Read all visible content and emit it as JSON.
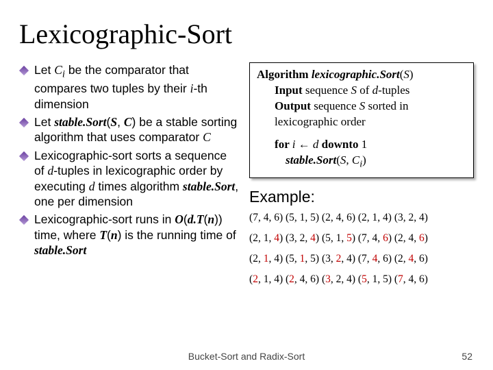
{
  "title": "Lexicographic-Sort",
  "bullets": {
    "b1a": "Let ",
    "b1b": "C",
    "b1c": "i",
    "b1d": " be the comparator that compares two tuples by their ",
    "b1e": "i",
    "b1f": "-th dimension",
    "b2a": "Let ",
    "b2b": "stable.Sort",
    "b2c": "(",
    "b2d": "S",
    "b2e": ", ",
    "b2f": "C",
    "b2g": ") be a stable sorting algorithm that uses comparator ",
    "b2h": "C",
    "b3a": "Lexicographic-sort sorts a sequence of ",
    "b3b": "d",
    "b3c": "-tuples in lexicographic order by executing ",
    "b3d": "d",
    "b3e": " times algorithm ",
    "b3f": "stable.Sort",
    "b3g": ", one per dimension",
    "b4a": "Lexicographic-sort runs in ",
    "b4b": "O",
    "b4c": "(",
    "b4d": "d.T",
    "b4e": "(",
    "b4f": "n",
    "b4g": ")) time, where ",
    "b4h": "T",
    "b4i": "(",
    "b4j": "n",
    "b4k": ") is the running time of ",
    "b4l": "stable.Sort"
  },
  "algo": {
    "l1a": "Algorithm ",
    "l1b": "lexicographic.Sort",
    "l1c": "(",
    "l1d": "S",
    "l1e": ")",
    "l2a": "Input ",
    "l2b": "sequence ",
    "l2c": "S",
    "l2d": " of ",
    "l2e": "d",
    "l2f": "-tuples",
    "l3a": "Output ",
    "l3b": "sequence ",
    "l3c": "S",
    "l3d": " sorted in lexicographic order",
    "l4a": "for ",
    "l4b": "i",
    "l4c": " ← ",
    "l4d": "d",
    "l4e": " downto ",
    "l4f": "1",
    "l5a": "stable.Sort",
    "l5b": "(",
    "l5c": "S",
    "l5d": ", ",
    "l5e": "C",
    "l5f": "i",
    "l5g": ")"
  },
  "example_head": "Example:",
  "ex": {
    "r1a": "(7, 4, 6) (5, 1, 5) (2, 4, 6) (2, 1, 4) (3, 2, 4)",
    "r2a": "(2, 1, ",
    "r2b": "4",
    "r2c": ") (3, 2, ",
    "r2d": "4",
    "r2e": ") (5, 1, ",
    "r2f": "5",
    "r2g": ") (7, 4, ",
    "r2h": "6",
    "r2i": ") (2, 4, ",
    "r2j": "6",
    "r2k": ")",
    "r3a": "(2, ",
    "r3b": "1",
    "r3c": ", 4) (5, ",
    "r3d": "1",
    "r3e": ", 5) (3, ",
    "r3f": "2",
    "r3g": ", 4) (7, ",
    "r3h": "4",
    "r3i": ", 6) (2, ",
    "r3j": "4",
    "r3k": ", 6)",
    "r4a": "(",
    "r4b": "2",
    "r4c": ", 1, 4) (",
    "r4d": "2",
    "r4e": ", 4, 6) (",
    "r4f": "3",
    "r4g": ", 2, 4) (",
    "r4h": "5",
    "r4i": ", 1, 5) (",
    "r4j": "7",
    "r4k": ", 4, 6)"
  },
  "footer_center": "Bucket-Sort and Radix-Sort",
  "footer_right": "52"
}
